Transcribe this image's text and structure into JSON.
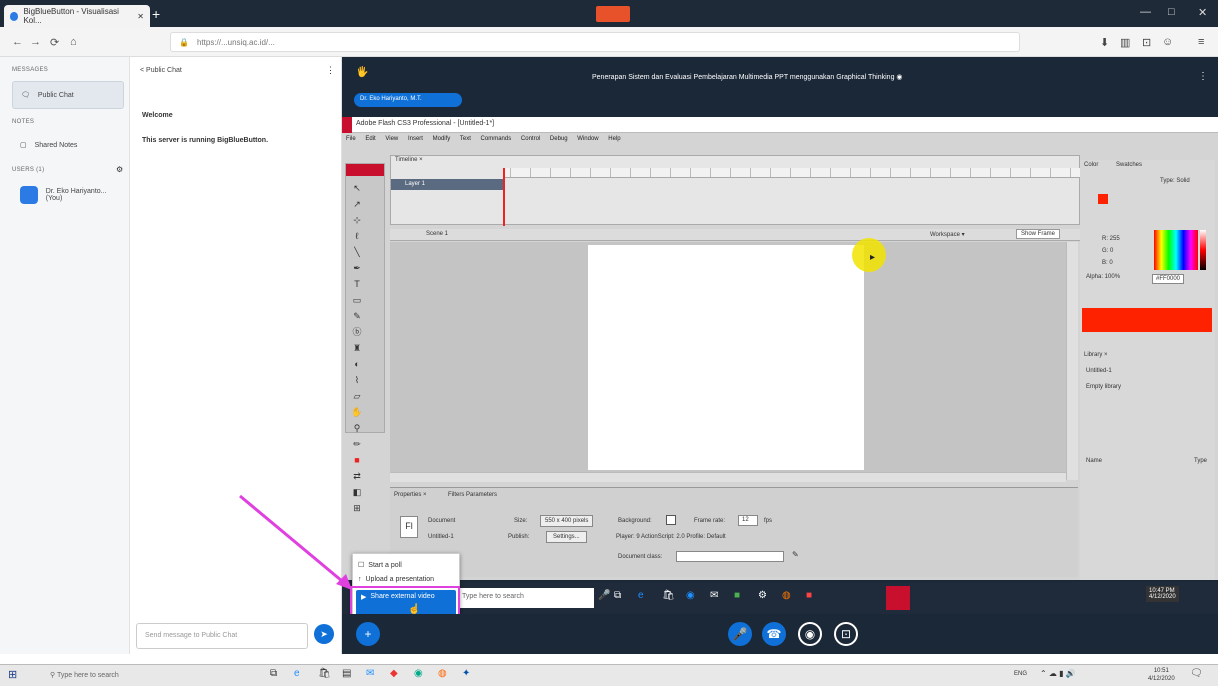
{
  "browser": {
    "tab_title": "BigBlueButton - Visualisasi Kol...",
    "new_tab": "+",
    "url": "https://...unsiq.ac.id/...",
    "window_controls": [
      "—",
      "□",
      "✕"
    ]
  },
  "sidebar": {
    "messages_section": "MESSAGES",
    "public_chat": "Public Chat",
    "notes_section": "NOTES",
    "shared_notes": "Shared Notes",
    "users_section": "USERS (1)",
    "user_name": "Dr. Eko Hariyanto... (You)"
  },
  "chat": {
    "header": "< Public Chat",
    "welcome_title": "Welcome",
    "welcome_body": "This server is running BigBlueButton.",
    "input_placeholder": "Send message to Public Chat"
  },
  "meeting": {
    "title": "Penerapan Sistem dan Evaluasi Pembelajaran Multimedia PPT menggunakan Graphical Thinking ◉",
    "presenter_pill": "Dr. Eko Hariyanto, M.T.",
    "whiteboard_mode": "🖐"
  },
  "flash": {
    "window_title": "Adobe Flash CS3 Professional - [Untitled-1*]",
    "menu": [
      "File",
      "Edit",
      "View",
      "Insert",
      "Modify",
      "Text",
      "Commands",
      "Control",
      "Debug",
      "Window",
      "Help"
    ],
    "timeline_tab": "Timeline ×",
    "layer_name": "Layer 1",
    "scene": "Scene 1",
    "workspace": "Workspace ▾",
    "zoom": "Show Frame",
    "props_tab": "Properties ×",
    "props_tab2": "Filters  Parameters",
    "doc_label": "Document",
    "doc_name": "Untitled-1",
    "size_label": "Size:",
    "size_value": "550 x 400 pixels",
    "bg_label": "Background:",
    "fps_label": "Frame rate:",
    "fps_value": "12",
    "fps_unit": "fps",
    "publish_label": "Publish:",
    "settings_btn": "Settings...",
    "player_label": "Player: 9    ActionScript: 2.0    Profile: Default",
    "docclass_label": "Document class:",
    "color_tab": "Color",
    "swatches_tab": "Swatches",
    "type_label": "Type: Solid",
    "rgb": [
      "R: 255",
      "G: 0",
      "B: 0"
    ],
    "alpha": "Alpha: 100%",
    "hex": "#FF0000",
    "library_tab": "Library ×",
    "library_doc": "Untitled-1",
    "library_empty": "Empty library",
    "name_col": "Name",
    "type_col": "Type"
  },
  "popup": {
    "items": [
      "Start a poll",
      "Upload a presentation",
      "Share external video"
    ],
    "selected_index": 2
  },
  "inner_taskbar": {
    "search": "Type here to search",
    "time": "10:47 PM",
    "date": "4/12/2020"
  },
  "controls": {
    "plus": "+",
    "mic": "🎤",
    "phone": "☎",
    "video": "◉",
    "screen": "⊡"
  },
  "taskbar": {
    "search_placeholder": "Type here to search",
    "time": "10:51",
    "date": "4/12/2020",
    "lang": "ENG"
  },
  "colors": {
    "accent": "#0f70d7",
    "dark": "#1b2838",
    "arrow": "#e040e0",
    "flash_red": "#ff2200"
  }
}
